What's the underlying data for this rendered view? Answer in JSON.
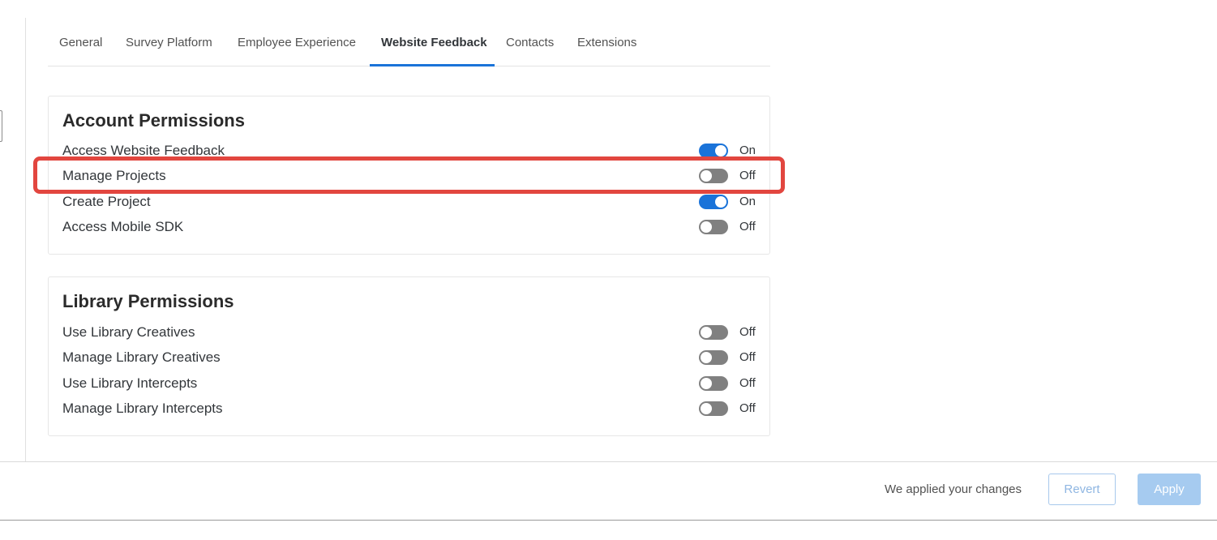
{
  "tabs": [
    {
      "label": "General",
      "active": false
    },
    {
      "label": "Survey Platform",
      "active": false
    },
    {
      "label": "Employee Experience",
      "active": false
    },
    {
      "label": "Website Feedback",
      "active": true
    },
    {
      "label": "Contacts",
      "active": false
    },
    {
      "label": "Extensions",
      "active": false
    }
  ],
  "account_permissions": {
    "title": "Account Permissions",
    "items": [
      {
        "label": "Access Website Feedback",
        "state": "On"
      },
      {
        "label": "Manage Projects",
        "state": "Off"
      },
      {
        "label": "Create Project",
        "state": "On"
      },
      {
        "label": "Access Mobile SDK",
        "state": "Off"
      }
    ]
  },
  "library_permissions": {
    "title": "Library Permissions",
    "items": [
      {
        "label": "Use Library Creatives",
        "state": "Off"
      },
      {
        "label": "Manage Library Creatives",
        "state": "Off"
      },
      {
        "label": "Use Library Intercepts",
        "state": "Off"
      },
      {
        "label": "Manage Library Intercepts",
        "state": "Off"
      }
    ]
  },
  "footer": {
    "status": "We applied your changes",
    "revert_label": "Revert",
    "apply_label": "Apply"
  },
  "colors": {
    "accent": "#1a73d9",
    "toggle_off": "#808080",
    "highlight": "#e2463f",
    "apply_disabled": "#a6cbf0"
  }
}
